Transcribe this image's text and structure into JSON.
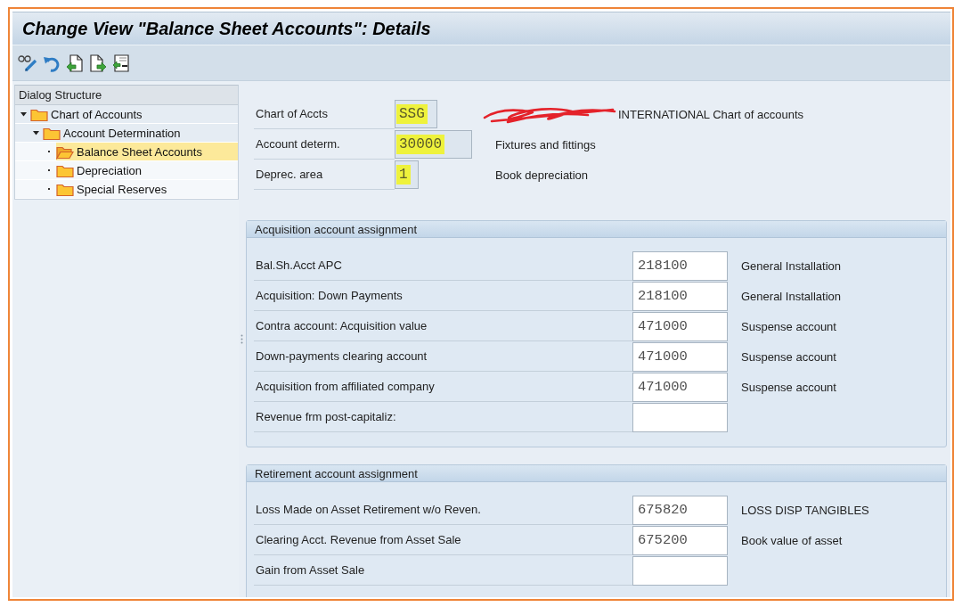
{
  "window": {
    "title": "Change View \"Balance Sheet Accounts\": Details"
  },
  "dialog_structure": {
    "title": "Dialog Structure",
    "items": [
      {
        "label": "Chart of Accounts",
        "expanded": true,
        "selected": false,
        "children": [
          {
            "label": "Account Determination",
            "expanded": true,
            "selected": false,
            "children": [
              {
                "label": "Balance Sheet Accounts",
                "selected": true
              },
              {
                "label": "Depreciation",
                "selected": false
              },
              {
                "label": "Special Reserves",
                "selected": false
              }
            ]
          }
        ]
      }
    ]
  },
  "header_fields": [
    {
      "label": "Chart of Accts",
      "value": "SSG",
      "highlighted": true,
      "redacted": true,
      "description": "INTERNATIONAL Chart of accounts"
    },
    {
      "label": "Account determ.",
      "value": "30000",
      "highlighted": true,
      "redacted": false,
      "description": "Fixtures and fittings"
    },
    {
      "label": "Deprec. area",
      "value": "1",
      "highlighted": true,
      "redacted": false,
      "description": "Book depreciation"
    }
  ],
  "groups": [
    {
      "title": "Acquisition account assignment",
      "rows": [
        {
          "label": "Bal.Sh.Acct APC",
          "value": "218100",
          "description": "General Installation"
        },
        {
          "label": "Acquisition: Down Payments",
          "value": "218100",
          "description": "General Installation"
        },
        {
          "label": "Contra account: Acquisition value",
          "value": "471000",
          "description": "Suspense account"
        },
        {
          "label": "Down-payments clearing account",
          "value": "471000",
          "description": "Suspense account"
        },
        {
          "label": "Acquisition from affiliated company",
          "value": "471000",
          "description": "Suspense account"
        },
        {
          "label": "Revenue frm post-capitaliz:"
        }
      ]
    },
    {
      "title": "Retirement account assignment",
      "rows": [
        {
          "label": "Loss Made on Asset Retirement w/o Reven.",
          "value": "675820",
          "description": "LOSS DISP TANGIBLES"
        },
        {
          "label": "Clearing Acct. Revenue from Asset Sale",
          "value": "675200",
          "description": "Book value of asset"
        },
        {
          "label": "Gain from Asset Sale"
        }
      ]
    }
  ]
}
